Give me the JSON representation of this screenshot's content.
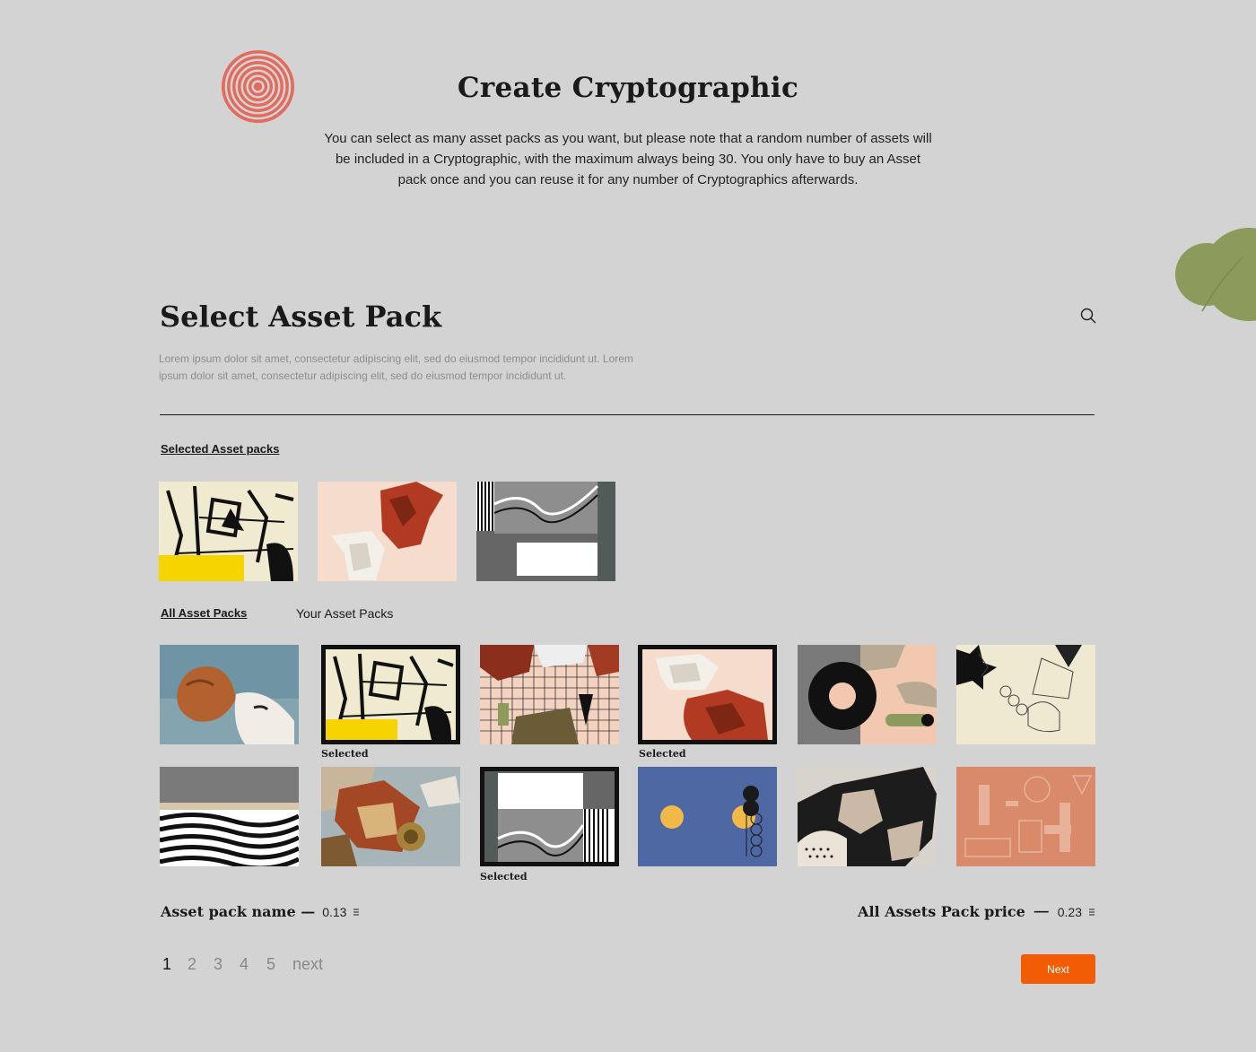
{
  "header": {
    "title": "Create Cryptographic",
    "intro": "You can select as many asset packs as you want, but please note that a random number of assets will be included in a Cryptographic, with the maximum always being 30. You only have to buy an Asset pack once and you can reuse it for any number of Cryptographics afterwards."
  },
  "section": {
    "title": "Select Asset Pack",
    "description": "Lorem ipsum dolor sit amet, consectetur adipiscing elit, sed do eiusmod tempor incididunt ut. Lorem ipsum dolor sit amet, consectetur adipiscing elit, sed do eiusmod tempor incididunt ut."
  },
  "selected": {
    "heading": "Selected Asset packs"
  },
  "tabs": {
    "all": "All Asset Packs",
    "yours": "Your Asset Packs"
  },
  "grid": {
    "selected_label": "Selected"
  },
  "pricing": {
    "name_label": "Asset pack name —",
    "name_value": "0.13",
    "all_label": "All Assets Pack price",
    "all_dash": "—",
    "all_value": "0.23",
    "currency_icon": "ethereum-icon"
  },
  "pagination": {
    "pages": [
      "1",
      "2",
      "3",
      "4",
      "5"
    ],
    "next": "next",
    "active": "1"
  },
  "actions": {
    "next_button": "Next"
  },
  "colors": {
    "background": "#d3d3d3",
    "accent": "#f25c05",
    "logo": "#e36b5d",
    "blob": "#8c9a5b"
  }
}
